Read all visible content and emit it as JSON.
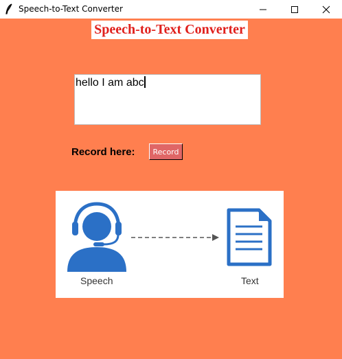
{
  "window": {
    "title": "Speech-to-Text Converter",
    "controls": {
      "minimize": "minimize-icon",
      "maximize": "maximize-icon",
      "close": "close-icon"
    }
  },
  "app": {
    "heading": "Speech-to-Text Converter",
    "textbox_value": "hello I am abc",
    "record_label": "Record here:",
    "record_button": "Record"
  },
  "illustration": {
    "speech_label": "Speech",
    "text_label": "Text",
    "icons": [
      "headset-person-icon",
      "dashed-arrow-icon",
      "document-icon"
    ]
  },
  "colors": {
    "background": "#ff7f4f",
    "heading_text": "#e0201c",
    "button_bg": "#e06666",
    "icon_blue": "#2b70c6"
  }
}
